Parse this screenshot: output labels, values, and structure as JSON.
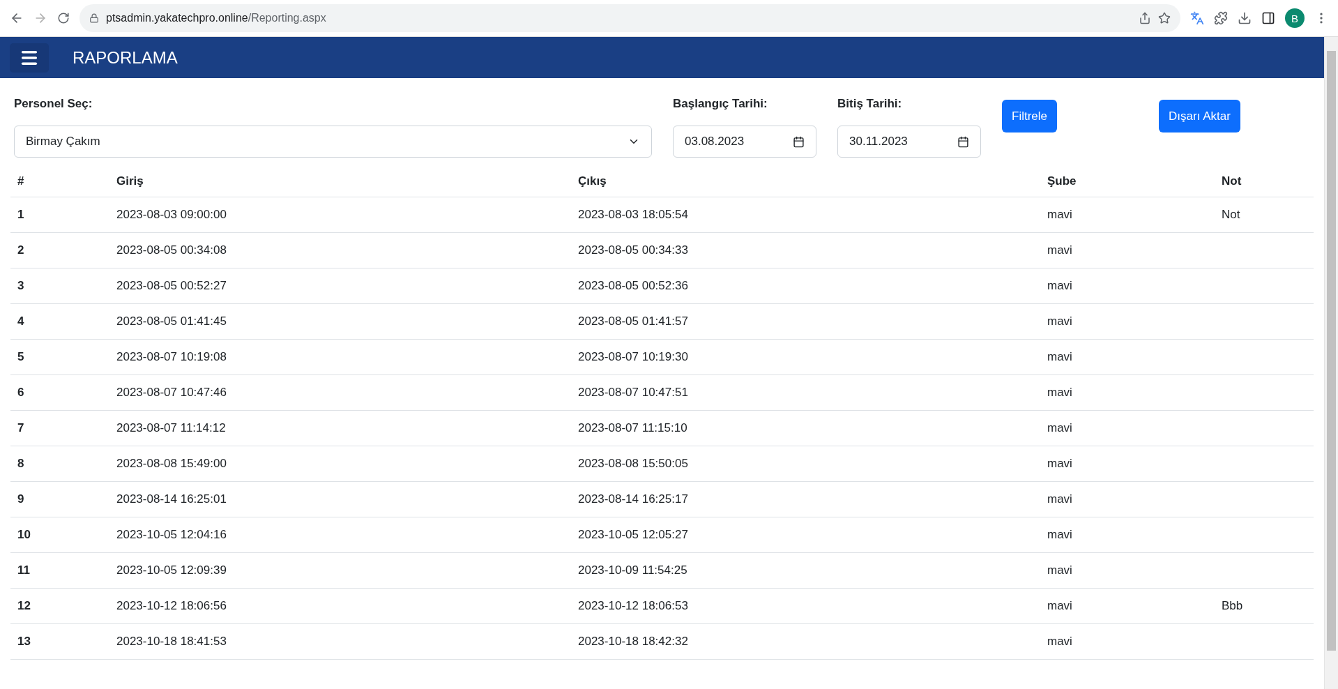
{
  "browser": {
    "url_host": "ptsadmin.yakatechpro.online",
    "url_path": "/Reporting.aspx",
    "profile_initial": "B"
  },
  "navbar": {
    "title": "RAPORLAMA"
  },
  "filters": {
    "personnel_label": "Personel Seç:",
    "personnel_value": "Birmay Çakım",
    "start_label": "Başlangıç Tarihi:",
    "start_value": "03.08.2023",
    "end_label": "Bitiş Tarihi:",
    "end_value": "30.11.2023",
    "filter_button": "Filtrele",
    "export_button": "Dışarı Aktar"
  },
  "table": {
    "columns": [
      "#",
      "Giriş",
      "Çıkış",
      "Şube",
      "Not"
    ],
    "rows": [
      [
        "1",
        "2023-08-03 09:00:00",
        "2023-08-03 18:05:54",
        "mavi",
        "Not"
      ],
      [
        "2",
        "2023-08-05 00:34:08",
        "2023-08-05 00:34:33",
        "mavi",
        ""
      ],
      [
        "3",
        "2023-08-05 00:52:27",
        "2023-08-05 00:52:36",
        "mavi",
        ""
      ],
      [
        "4",
        "2023-08-05 01:41:45",
        "2023-08-05 01:41:57",
        "mavi",
        ""
      ],
      [
        "5",
        "2023-08-07 10:19:08",
        "2023-08-07 10:19:30",
        "mavi",
        ""
      ],
      [
        "6",
        "2023-08-07 10:47:46",
        "2023-08-07 10:47:51",
        "mavi",
        ""
      ],
      [
        "7",
        "2023-08-07 11:14:12",
        "2023-08-07 11:15:10",
        "mavi",
        ""
      ],
      [
        "8",
        "2023-08-08 15:49:00",
        "2023-08-08 15:50:05",
        "mavi",
        ""
      ],
      [
        "9",
        "2023-08-14 16:25:01",
        "2023-08-14 16:25:17",
        "mavi",
        ""
      ],
      [
        "10",
        "2023-10-05 12:04:16",
        "2023-10-05 12:05:27",
        "mavi",
        ""
      ],
      [
        "11",
        "2023-10-05 12:09:39",
        "2023-10-09 11:54:25",
        "mavi",
        ""
      ],
      [
        "12",
        "2023-10-12 18:06:56",
        "2023-10-12 18:06:53",
        "mavi",
        "Bbb"
      ],
      [
        "13",
        "2023-10-18 18:41:53",
        "2023-10-18 18:42:32",
        "mavi",
        ""
      ]
    ]
  }
}
